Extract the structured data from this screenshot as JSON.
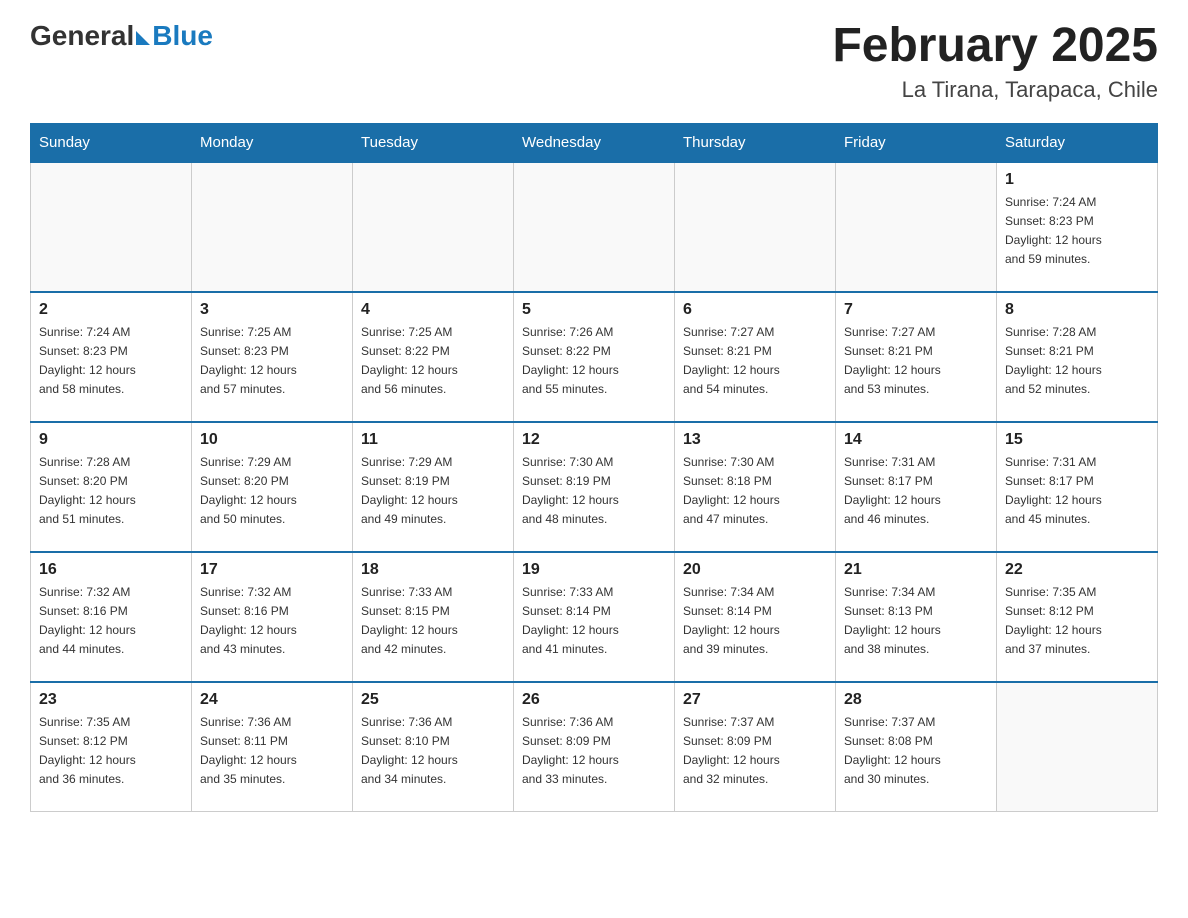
{
  "header": {
    "logo_general": "General",
    "logo_blue": "Blue",
    "month_title": "February 2025",
    "location": "La Tirana, Tarapaca, Chile"
  },
  "days_of_week": [
    "Sunday",
    "Monday",
    "Tuesday",
    "Wednesday",
    "Thursday",
    "Friday",
    "Saturday"
  ],
  "weeks": [
    [
      {
        "day": "",
        "info": ""
      },
      {
        "day": "",
        "info": ""
      },
      {
        "day": "",
        "info": ""
      },
      {
        "day": "",
        "info": ""
      },
      {
        "day": "",
        "info": ""
      },
      {
        "day": "",
        "info": ""
      },
      {
        "day": "1",
        "info": "Sunrise: 7:24 AM\nSunset: 8:23 PM\nDaylight: 12 hours\nand 59 minutes."
      }
    ],
    [
      {
        "day": "2",
        "info": "Sunrise: 7:24 AM\nSunset: 8:23 PM\nDaylight: 12 hours\nand 58 minutes."
      },
      {
        "day": "3",
        "info": "Sunrise: 7:25 AM\nSunset: 8:23 PM\nDaylight: 12 hours\nand 57 minutes."
      },
      {
        "day": "4",
        "info": "Sunrise: 7:25 AM\nSunset: 8:22 PM\nDaylight: 12 hours\nand 56 minutes."
      },
      {
        "day": "5",
        "info": "Sunrise: 7:26 AM\nSunset: 8:22 PM\nDaylight: 12 hours\nand 55 minutes."
      },
      {
        "day": "6",
        "info": "Sunrise: 7:27 AM\nSunset: 8:21 PM\nDaylight: 12 hours\nand 54 minutes."
      },
      {
        "day": "7",
        "info": "Sunrise: 7:27 AM\nSunset: 8:21 PM\nDaylight: 12 hours\nand 53 minutes."
      },
      {
        "day": "8",
        "info": "Sunrise: 7:28 AM\nSunset: 8:21 PM\nDaylight: 12 hours\nand 52 minutes."
      }
    ],
    [
      {
        "day": "9",
        "info": "Sunrise: 7:28 AM\nSunset: 8:20 PM\nDaylight: 12 hours\nand 51 minutes."
      },
      {
        "day": "10",
        "info": "Sunrise: 7:29 AM\nSunset: 8:20 PM\nDaylight: 12 hours\nand 50 minutes."
      },
      {
        "day": "11",
        "info": "Sunrise: 7:29 AM\nSunset: 8:19 PM\nDaylight: 12 hours\nand 49 minutes."
      },
      {
        "day": "12",
        "info": "Sunrise: 7:30 AM\nSunset: 8:19 PM\nDaylight: 12 hours\nand 48 minutes."
      },
      {
        "day": "13",
        "info": "Sunrise: 7:30 AM\nSunset: 8:18 PM\nDaylight: 12 hours\nand 47 minutes."
      },
      {
        "day": "14",
        "info": "Sunrise: 7:31 AM\nSunset: 8:17 PM\nDaylight: 12 hours\nand 46 minutes."
      },
      {
        "day": "15",
        "info": "Sunrise: 7:31 AM\nSunset: 8:17 PM\nDaylight: 12 hours\nand 45 minutes."
      }
    ],
    [
      {
        "day": "16",
        "info": "Sunrise: 7:32 AM\nSunset: 8:16 PM\nDaylight: 12 hours\nand 44 minutes."
      },
      {
        "day": "17",
        "info": "Sunrise: 7:32 AM\nSunset: 8:16 PM\nDaylight: 12 hours\nand 43 minutes."
      },
      {
        "day": "18",
        "info": "Sunrise: 7:33 AM\nSunset: 8:15 PM\nDaylight: 12 hours\nand 42 minutes."
      },
      {
        "day": "19",
        "info": "Sunrise: 7:33 AM\nSunset: 8:14 PM\nDaylight: 12 hours\nand 41 minutes."
      },
      {
        "day": "20",
        "info": "Sunrise: 7:34 AM\nSunset: 8:14 PM\nDaylight: 12 hours\nand 39 minutes."
      },
      {
        "day": "21",
        "info": "Sunrise: 7:34 AM\nSunset: 8:13 PM\nDaylight: 12 hours\nand 38 minutes."
      },
      {
        "day": "22",
        "info": "Sunrise: 7:35 AM\nSunset: 8:12 PM\nDaylight: 12 hours\nand 37 minutes."
      }
    ],
    [
      {
        "day": "23",
        "info": "Sunrise: 7:35 AM\nSunset: 8:12 PM\nDaylight: 12 hours\nand 36 minutes."
      },
      {
        "day": "24",
        "info": "Sunrise: 7:36 AM\nSunset: 8:11 PM\nDaylight: 12 hours\nand 35 minutes."
      },
      {
        "day": "25",
        "info": "Sunrise: 7:36 AM\nSunset: 8:10 PM\nDaylight: 12 hours\nand 34 minutes."
      },
      {
        "day": "26",
        "info": "Sunrise: 7:36 AM\nSunset: 8:09 PM\nDaylight: 12 hours\nand 33 minutes."
      },
      {
        "day": "27",
        "info": "Sunrise: 7:37 AM\nSunset: 8:09 PM\nDaylight: 12 hours\nand 32 minutes."
      },
      {
        "day": "28",
        "info": "Sunrise: 7:37 AM\nSunset: 8:08 PM\nDaylight: 12 hours\nand 30 minutes."
      },
      {
        "day": "",
        "info": ""
      }
    ]
  ]
}
